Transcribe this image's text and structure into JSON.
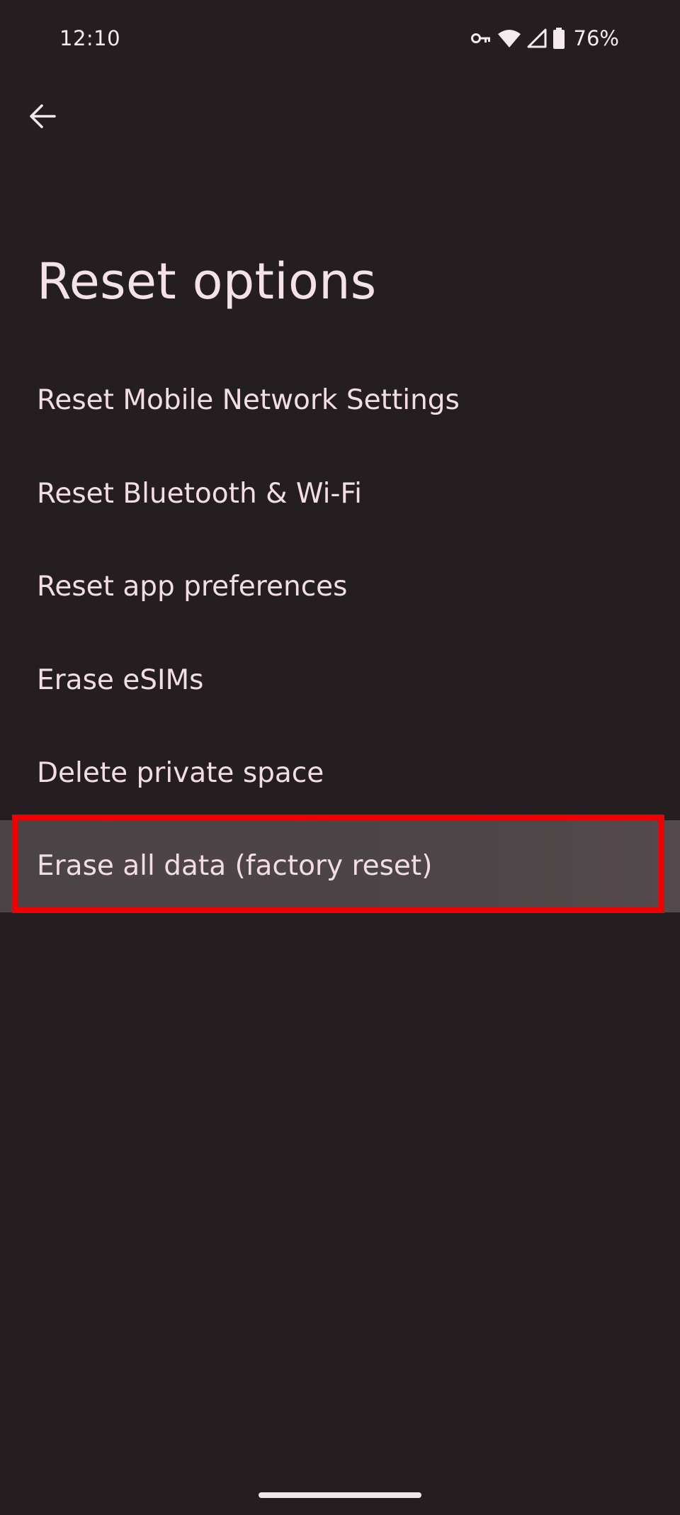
{
  "status_bar": {
    "time": "12:10",
    "battery_percent": "76%",
    "icons": [
      "vpn-key-icon",
      "wifi-icon",
      "cellular-signal-icon",
      "battery-icon"
    ]
  },
  "header": {
    "back_icon": "arrow-back-icon",
    "title": "Reset options"
  },
  "options": [
    {
      "label": "Reset Mobile Network Settings"
    },
    {
      "label": "Reset Bluetooth & Wi-Fi"
    },
    {
      "label": "Reset app preferences"
    },
    {
      "label": "Erase eSIMs"
    },
    {
      "label": "Delete private space"
    },
    {
      "label": "Erase all data (factory reset)",
      "highlighted": true
    }
  ],
  "colors": {
    "background": "#241e21",
    "text": "#f1dde2",
    "highlight_row": "#4d4547",
    "annotation_frame": "#f00000"
  }
}
